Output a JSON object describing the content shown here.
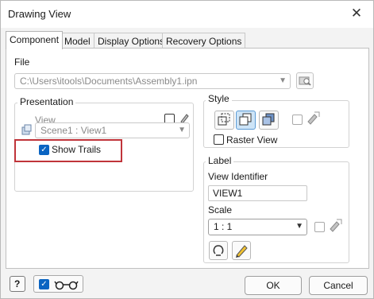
{
  "window": {
    "title": "Drawing View",
    "close_glyph": "✕"
  },
  "tabs": [
    {
      "label": "Component",
      "active": true
    },
    {
      "label": "Model",
      "active": false
    },
    {
      "label": "Display Options",
      "active": false
    },
    {
      "label": "Recovery Options",
      "active": false
    }
  ],
  "file": {
    "label": "File",
    "path": "C:\\Users\\itools\\Documents\\Assembly1.ipn"
  },
  "presentation": {
    "title": "Presentation",
    "view_label": "View",
    "scene_value": "Scene1 : View1",
    "show_trails_label": "Show Trails",
    "show_trails_checked": true
  },
  "style": {
    "title": "Style",
    "raster_view_label": "Raster View",
    "raster_view_checked": false,
    "selected_style": "hidden-line-removed"
  },
  "label_group": {
    "title": "Label",
    "view_identifier_label": "View Identifier",
    "view_identifier_value": "VIEW1",
    "scale_label": "Scale",
    "scale_value": "1 : 1"
  },
  "footer": {
    "ok_label": "OK",
    "cancel_label": "Cancel",
    "checkbox_checked": true
  },
  "colors": {
    "accent": "#0a64c2",
    "highlight": "#c0343a"
  }
}
